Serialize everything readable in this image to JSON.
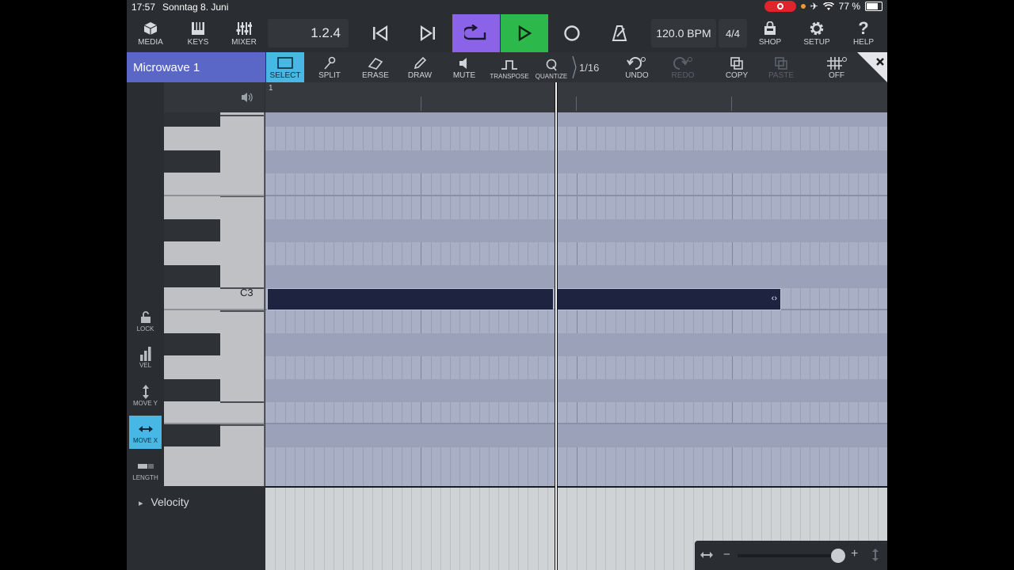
{
  "status_bar": {
    "time": "17:57",
    "date": "Sonntag 8. Juni",
    "battery": "77 %",
    "battery_level": 0.77
  },
  "toolbar": {
    "media_label": "MEDIA",
    "keys_label": "KEYS",
    "mixer_label": "MIXER",
    "position": "1.2.4",
    "tempo": "120.0 BPM",
    "time_signature": "4/4",
    "shop_label": "SHOP",
    "setup_label": "SETUP",
    "help_label": "HELP",
    "cycle_color": "#8a63e8",
    "play_color": "#2db84b"
  },
  "editor": {
    "track_name": "Microwave 1",
    "tools": {
      "select": "SELECT",
      "split": "SPLIT",
      "erase": "ERASE",
      "draw": "DRAW",
      "mute": "MUTE",
      "transpose": "TRANSPOSE",
      "quantize": "QUANTIZE",
      "quantize_value": "1/16",
      "undo": "UNDO",
      "redo": "REDO",
      "copy": "COPY",
      "paste": "PASTE",
      "grid": "OFF"
    },
    "accent_color": "#47b8e6"
  },
  "left_tools": {
    "lock": "LOCK",
    "vel": "VEL",
    "move_y": "MOVE Y",
    "move_x": "MOVE X",
    "length": "LENGTH"
  },
  "ruler": {
    "bar_number": "1"
  },
  "keyboard": {
    "c3_label": "C3"
  },
  "velocity": {
    "title": "Velocity",
    "expand_glyph": "▸"
  },
  "zoom": {
    "minus": "−",
    "plus": "+"
  }
}
